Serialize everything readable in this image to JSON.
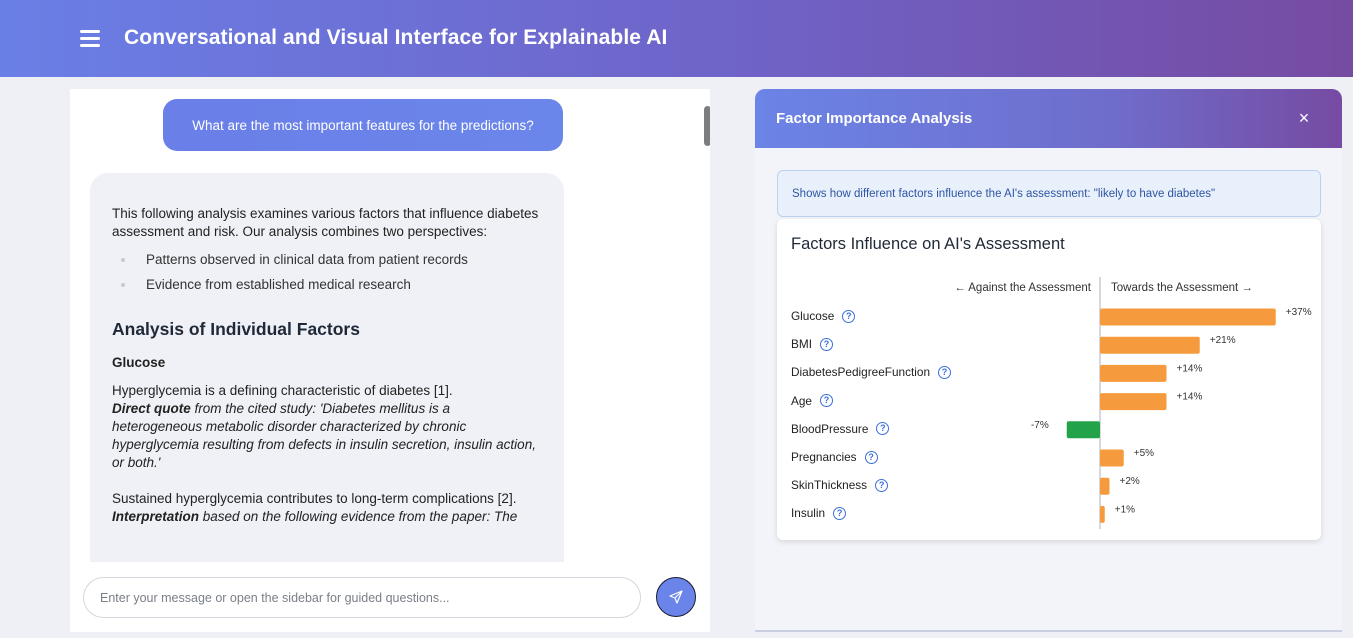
{
  "app": {
    "title": "Conversational and Visual Interface for Explainable AI"
  },
  "chat": {
    "user_message": "What are the most important features for the predictions?",
    "ai": {
      "intro": "This following analysis examines various factors that influence diabetes assessment and risk. Our analysis combines two perspectives:",
      "perspectives": [
        "Patterns observed in clinical data from patient records",
        "Evidence from established medical research"
      ],
      "heading": "Analysis of Individual Factors",
      "subheading": "Glucose",
      "p1_text": "Hyperglycemia is a defining characteristic of diabetes [1].",
      "p1_bold": "Direct quote",
      "p1_quote": " from the cited study: 'Diabetes mellitus is a heterogeneous metabolic disorder characterized by chronic hyperglycemia resulting from defects in insulin secretion, insulin action, or both.'",
      "p2_text": "Sustained hyperglycemia contributes to long-term complications [2].",
      "p2_bold": "Interpretation",
      "p2_rest": " based on the following evidence from the paper: The"
    },
    "input_placeholder": "Enter your message or open the sidebar for guided questions..."
  },
  "factor_panel": {
    "title": "Factor Importance Analysis",
    "close_symbol": "×",
    "info": "Shows how different factors influence the AI's assessment: \"likely to have diabetes\"",
    "chart_title": "Factors Influence on AI's Assessment",
    "axis_left": "← Against the Assessment",
    "axis_right": "Towards the Assessment →",
    "help_symbol": "?"
  },
  "chart_data": {
    "type": "bar",
    "orientation": "horizontal-diverging",
    "title": "Factors Influence on AI's Assessment",
    "xlabel_negative": "← Against the Assessment",
    "xlabel_positive": "Towards the Assessment →",
    "categories": [
      "Glucose",
      "BMI",
      "DiabetesPedigreeFunction",
      "Age",
      "BloodPressure",
      "Pregnancies",
      "SkinThickness",
      "Insulin"
    ],
    "values": [
      37,
      21,
      14,
      14,
      -7,
      5,
      2,
      1
    ],
    "value_labels": [
      "+37%",
      "+21%",
      "+14%",
      "+14%",
      "-7%",
      "+5%",
      "+2%",
      "+1%"
    ],
    "unit": "%",
    "colors": {
      "positive": "#f59b3d",
      "negative": "#22a34a"
    }
  },
  "colors": {
    "header_start": "#6a7fe6",
    "header_end": "#764ba2",
    "accent": "#6b84ea"
  }
}
